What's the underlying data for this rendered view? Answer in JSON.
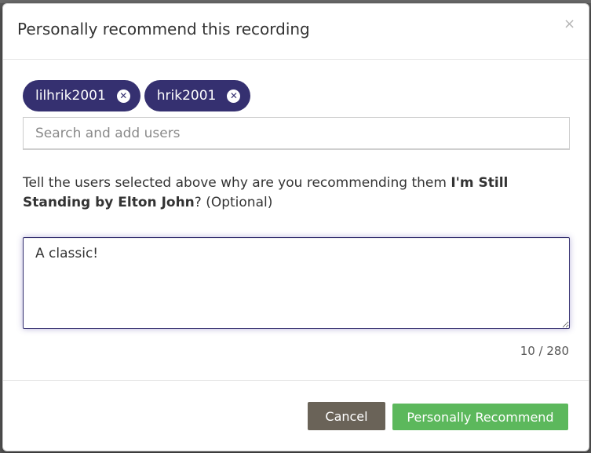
{
  "dialog": {
    "title": "Personally recommend this recording",
    "close_glyph": "×"
  },
  "selected_users": [
    {
      "name": "lilhrik2001",
      "remove_glyph": "✕"
    },
    {
      "name": "hrik2001",
      "remove_glyph": "✕"
    }
  ],
  "search": {
    "placeholder": "Search and add users",
    "value": ""
  },
  "prompt": {
    "prefix": "Tell the users selected above why are you recommending them ",
    "recording": "I'm Still Standing by Elton John",
    "suffix": "? (Optional)"
  },
  "message": {
    "value": "A classic!",
    "char_count": "10 / 280"
  },
  "footer": {
    "cancel_label": "Cancel",
    "recommend_label": "Personally Recommend"
  },
  "colors": {
    "pill_bg": "#353070",
    "cancel_bg": "#6a6358",
    "recommend_bg": "#5cb85c"
  },
  "icons": {
    "close": "close-icon",
    "pill_remove": "remove-circle-icon"
  }
}
